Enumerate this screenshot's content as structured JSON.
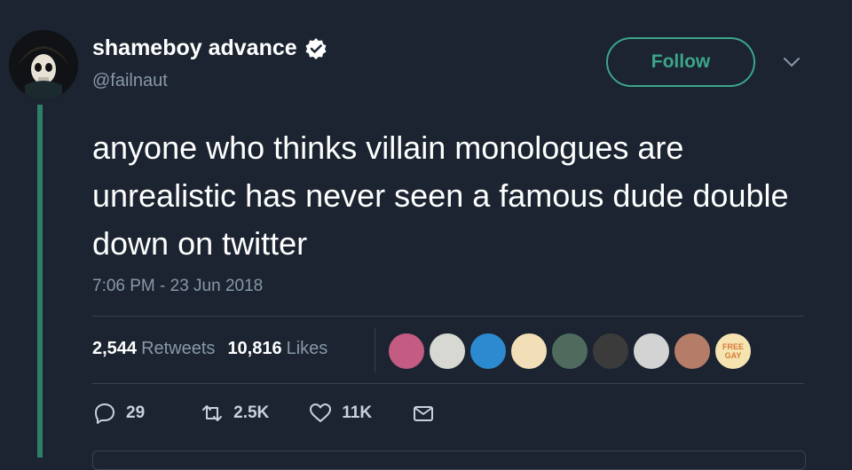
{
  "user": {
    "display_name": "shameboy advance",
    "handle": "@failnaut",
    "avatar_icon": "skull-avatar"
  },
  "follow_label": "Follow",
  "tweet": {
    "text": "anyone who thinks villain monologues are unrealistic has never seen a famous dude double down on twitter",
    "timestamp": "7:06 PM - 23 Jun 2018"
  },
  "stats": {
    "retweets_count": "2,544",
    "retweets_label": "Retweets",
    "likes_count": "10,816",
    "likes_label": "Likes"
  },
  "likers": [
    {
      "name": "liker-1",
      "color": "#c35b83"
    },
    {
      "name": "liker-2",
      "color": "#d8d8d2"
    },
    {
      "name": "liker-3",
      "color": "#2c8ad0"
    },
    {
      "name": "liker-4",
      "color": "#f2dfb7"
    },
    {
      "name": "liker-5",
      "color": "#4f6b5e"
    },
    {
      "name": "liker-6",
      "color": "#3b3b3b"
    },
    {
      "name": "liker-7",
      "color": "#d3d3d3"
    },
    {
      "name": "liker-8",
      "color": "#b57c67"
    },
    {
      "name": "liker-9",
      "color": "#f5e3b0",
      "text": "FREE GAY"
    }
  ],
  "actions": {
    "reply_count": "29",
    "retweet_count": "2.5K",
    "like_count": "11K"
  },
  "colors": {
    "background": "#1b2430",
    "accent": "#3ca58a",
    "muted": "#8899a6",
    "thread_line": "#2f7f66"
  }
}
